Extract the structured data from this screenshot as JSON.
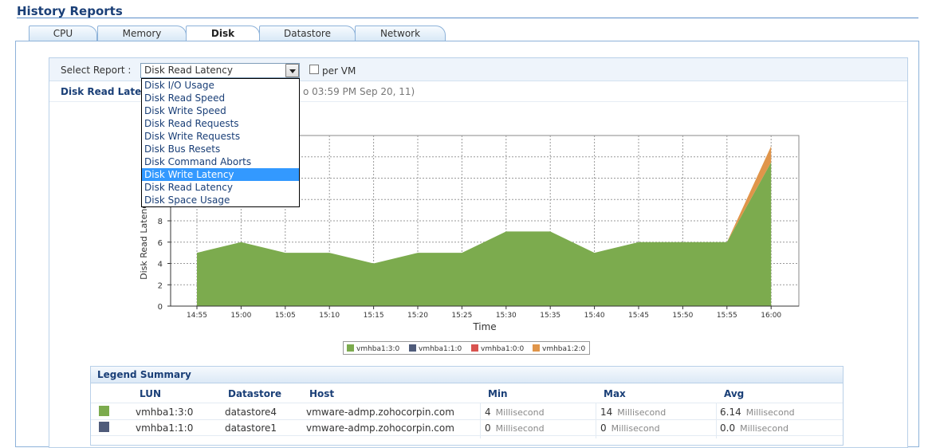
{
  "page": {
    "title": "History Reports"
  },
  "tabs": [
    {
      "label": "CPU",
      "active": false
    },
    {
      "label": "Memory",
      "active": false
    },
    {
      "label": "Disk",
      "active": true
    },
    {
      "label": "Datastore",
      "active": false
    },
    {
      "label": "Network",
      "active": false
    }
  ],
  "toolbar": {
    "select_label": "Select Report :",
    "selected_value": "Disk Read Latency",
    "per_vm_label": "per VM",
    "per_vm_checked": false
  },
  "dropdown": {
    "options": [
      "Disk I/O Usage",
      "Disk Read Speed",
      "Disk Write Speed",
      "Disk Read Requests",
      "Disk Write Requests",
      "Disk Bus Resets",
      "Disk Command Aborts",
      "Disk Write Latency",
      "Disk Read Latency",
      "Disk Space Usage"
    ],
    "highlighted_index": 7
  },
  "report": {
    "title": "Disk Read Late",
    "period": "o 03:59 PM Sep 20, 11)"
  },
  "chart_data": {
    "type": "area",
    "xlabel": "Time",
    "ylabel": "Disk Read Latency",
    "ylim": [
      0,
      16
    ],
    "y_ticks_visible": [
      0,
      2,
      4,
      6,
      8
    ],
    "grid": true,
    "categories": [
      "14:55",
      "15:00",
      "15:05",
      "15:10",
      "15:15",
      "15:20",
      "15:25",
      "15:30",
      "15:35",
      "15:40",
      "15:45",
      "15:50",
      "15:55",
      "16:00"
    ],
    "series": [
      {
        "name": "vmhba1:3:0",
        "color": "#7cab4e",
        "values": [
          5,
          6,
          5,
          5,
          4,
          5,
          5,
          7,
          7,
          5,
          6,
          6,
          6,
          13.5
        ]
      },
      {
        "name": "vmhba1:1:0",
        "color": "#4f5b7a",
        "values": [
          0,
          0,
          0,
          0,
          0,
          0,
          0,
          0,
          0,
          0,
          0,
          0,
          0,
          0
        ]
      },
      {
        "name": "vmhba1:0:0",
        "color": "#d9534f",
        "values": [
          0,
          0,
          0,
          0,
          0,
          0,
          0,
          0,
          0,
          0,
          0,
          0,
          0,
          0
        ]
      },
      {
        "name": "vmhba1:2:0",
        "color": "#e0954a",
        "values": [
          0,
          0,
          0,
          0,
          0,
          0,
          0,
          0,
          0,
          0,
          0,
          0,
          0,
          1.5
        ]
      }
    ]
  },
  "legend_summary": {
    "title": "Legend Summary",
    "columns": [
      "LUN",
      "Datastore",
      "Host",
      "Min",
      "Max",
      "Avg"
    ],
    "rows": [
      {
        "color": "#7cab4e",
        "lun": "vmhba1:3:0",
        "datastore": "datastore4",
        "host": "vmware-admp.zohocorpin.com",
        "min": "4",
        "min_unit": "Millisecond",
        "max": "14",
        "max_unit": "Millisecond",
        "avg": "6.14",
        "avg_unit": "Millisecond"
      },
      {
        "color": "#4f5b7a",
        "lun": "vmhba1:1:0",
        "datastore": "datastore1",
        "host": "vmware-admp.zohocorpin.com",
        "min": "0",
        "min_unit": "Millisecond",
        "max": "0",
        "max_unit": "Millisecond",
        "avg": "0.0",
        "avg_unit": "Millisecond"
      }
    ]
  }
}
